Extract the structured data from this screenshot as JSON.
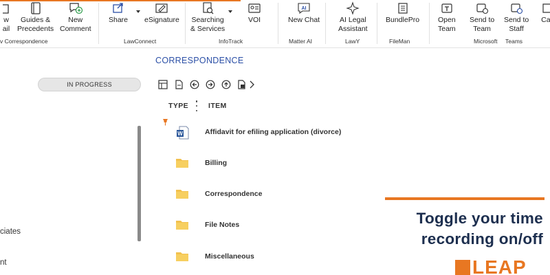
{
  "ribbon": {
    "buttons": {
      "new_mail": "w\nail",
      "guides": "Guides &\nPrecedents",
      "new_comment": "New\nComment",
      "share": "Share",
      "esignature": "eSignature",
      "searching": "Searching\n& Services",
      "voi": "VOI",
      "new_chat": "New Chat",
      "ai_legal": "AI Legal\nAssistant",
      "bundlepro": "BundlePro",
      "open_team": "Open\nTeam",
      "send_team": "Send to\nTeam",
      "send_staff": "Send to\nStaff",
      "cal": "Cal"
    },
    "groups": {
      "correspondence": "v Correspondence",
      "lawconnect": "LawConnect",
      "infotrack": "InfoTrack",
      "matter_ai": "Matter AI",
      "lawy": "LawY",
      "fileman": "FileMan",
      "microsoft": "Microsoft",
      "teams": "Teams"
    },
    "ai_badge": "AI"
  },
  "left": {
    "status": "IN PROGRESS",
    "items": [
      "ciates",
      "nt"
    ]
  },
  "main": {
    "title": "CORRESPONDENCE",
    "columns": {
      "type": "TYPE",
      "item": "ITEM"
    },
    "rows": [
      {
        "name": "Affidavit for efiling application (divorce)",
        "type": "word-doc"
      },
      {
        "name": "Billing",
        "type": "folder"
      },
      {
        "name": "Correspondence",
        "type": "folder"
      },
      {
        "name": "File Notes",
        "type": "folder"
      },
      {
        "name": "Miscellaneous",
        "type": "folder"
      }
    ],
    "icons": [
      "layout-icon",
      "document-icon",
      "back-icon",
      "forward-icon",
      "up-icon",
      "document-export-icon",
      "chevron-right-icon"
    ]
  },
  "promo": {
    "line1": "Toggle your time",
    "line2": "recording on/off",
    "logo": "LEAP"
  },
  "colors": {
    "accent": "#e87722",
    "title_blue": "#2b4fa6",
    "promo_navy": "#1d2f4f",
    "folder": "#f2c14e"
  }
}
